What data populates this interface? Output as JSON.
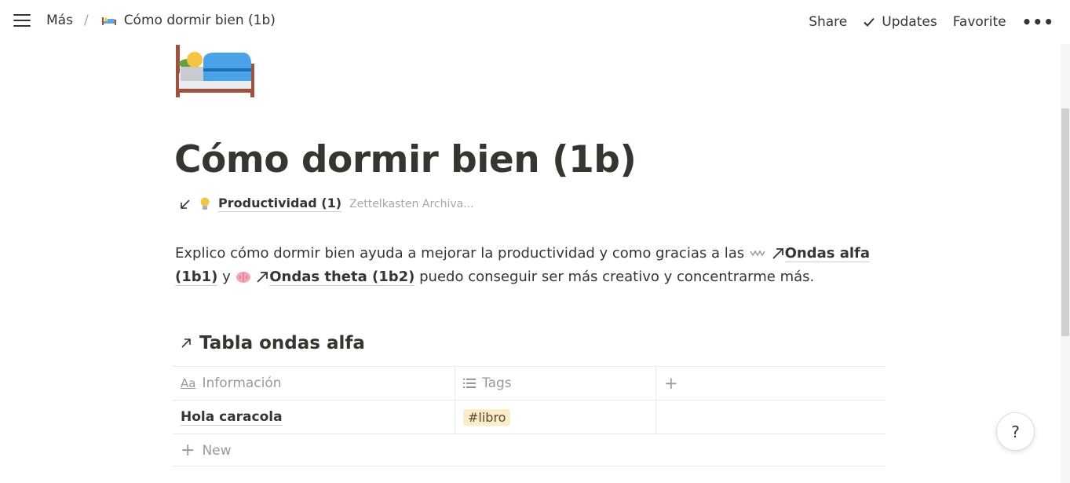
{
  "header": {
    "breadcrumb_root": "Más",
    "breadcrumb_sep": "/",
    "breadcrumb_page": "Cómo dormir bien (1b)",
    "actions": {
      "share": "Share",
      "updates": "Updates",
      "favorite": "Favorite",
      "more": "•••"
    }
  },
  "page": {
    "title": "Cómo dormir bien (1b)",
    "icon": "bed-icon",
    "property": {
      "link": "Productividad (1)",
      "meta": "Zettelkasten Archiva..."
    },
    "paragraph": {
      "part1": "Explico cómo dormir bien ayuda a mejorar la productividad y como gracias a las ",
      "link1": "Ondas alfa (1b1)",
      "part2": "  y ",
      "link2": "Ondas theta (1b2)",
      "part3": " puedo conseguir ser más creativo y concentrarme más."
    }
  },
  "database": {
    "title": "Tabla ondas alfa",
    "columns": [
      {
        "label": "Información",
        "icon": "Aa"
      },
      {
        "label": "Tags",
        "icon": "list-icon"
      },
      {
        "label": "+",
        "icon": "plus-icon"
      }
    ],
    "rows": [
      {
        "name": "Hola caracola",
        "tag": "#libro"
      }
    ],
    "new_label": "New"
  },
  "help": {
    "label": "?"
  },
  "colors": {
    "text": "#37352f",
    "muted": "#9b9a97",
    "tag_bg": "#fbecca",
    "border": "#e9e9e7"
  }
}
